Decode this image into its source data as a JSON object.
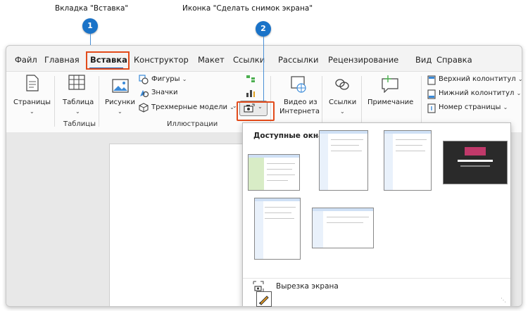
{
  "callouts": {
    "one": {
      "number": "1",
      "text": "Вкладка \"Вставка\""
    },
    "two": {
      "number": "2",
      "text": "Иконка \"Сделать снимок экрана\""
    }
  },
  "tabs": [
    "Файл",
    "Главная",
    "Вставка",
    "Конструктор",
    "Макет",
    "Ссылки",
    "Рассылки",
    "Рецензирование",
    "Вид",
    "Справка"
  ],
  "ribbon": {
    "pages": "Страницы",
    "table": "Таблица",
    "tables_group": "Таблицы",
    "pictures": "Рисунки",
    "shapes": "Фигуры",
    "icons": "Значки",
    "models3d": "Трехмерные модели",
    "illustrations_group": "Иллюстрации",
    "video_line1": "Видео из",
    "video_line2": "Интернета",
    "links": "Ссылки",
    "comment": "Примечание",
    "header": "Верхний колонтитул",
    "footer": "Нижний колонтитул",
    "page_number": "Номер страницы"
  },
  "dropdown": {
    "title": "Доступные окна",
    "screen_clipping": "Вырезка экрана"
  },
  "colors": {
    "accent": "#1a73c8",
    "highlight_box": "#e24b1b",
    "tab_underline": "#1a5fb4"
  }
}
